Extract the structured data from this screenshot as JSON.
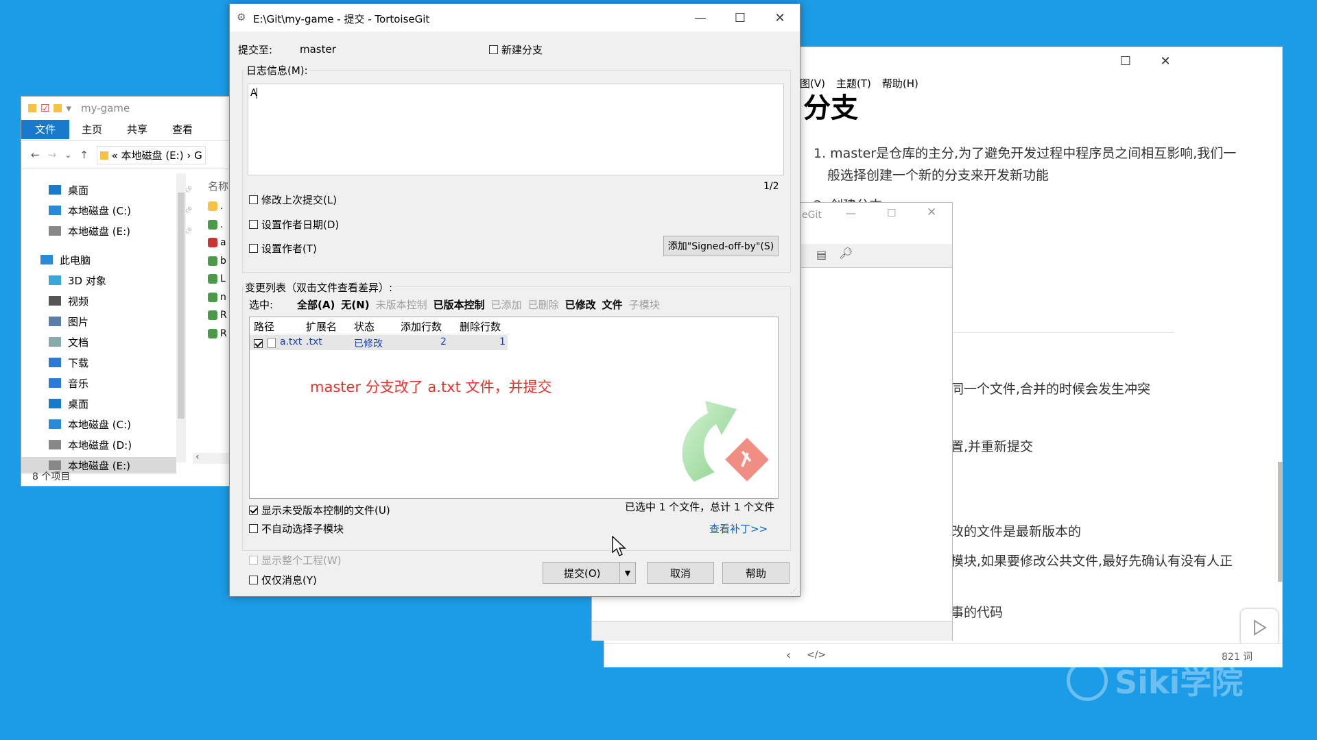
{
  "explorer": {
    "title": "my-game",
    "ribbon_tabs": [
      "文件",
      "主页",
      "共享",
      "查看"
    ],
    "address": "本地磁盘 (E:)",
    "address_prefix": "«",
    "address_next": "G",
    "column_name": "名称",
    "nav_items": [
      "桌面",
      "本地磁盘 (C:)",
      "本地磁盘 (E:)",
      "此电脑",
      "3D 对象",
      "视频",
      "图片",
      "文档",
      "下载",
      "音乐",
      "桌面",
      "本地磁盘 (C:)",
      "本地磁盘 (D:)",
      "本地磁盘 (E:)"
    ],
    "file_letters": [
      ".",
      ".",
      "a",
      "b",
      "L",
      "n",
      "R",
      "R"
    ],
    "status": "8 个项目"
  },
  "doc": {
    "menu": [
      "图(V)",
      "主题(T)",
      "帮助(H)"
    ],
    "heading": "分支",
    "list1": "1. master是仓库的主分,为了避免开发过程中程序员之间相互影响,我们一",
    "list1b": "般选择创建一个新的分支来开发新功能",
    "list2": "2. 创建分支",
    "p1": "同一个文件,合并的时候会发生冲突",
    "p2": "置,并重新提交",
    "p3": "改的文件是最新版本的",
    "p4": "模块,如果要修改公共文件,最好先确认有没有人正",
    "p5": "事的代码",
    "word_count": "821 词",
    "code_icon": "</>"
  },
  "tgit2": {
    "title": "eGit"
  },
  "dialog": {
    "title": "E:\\Git\\my-game - 提交 - TortoiseGit",
    "commit_to_label": "提交至:",
    "branch": "master",
    "new_branch": "新建分支",
    "log_label": "日志信息(M):",
    "message": "A",
    "page_indicator": "1/2",
    "amend": "修改上次提交(L)",
    "set_date": "设置作者日期(D)",
    "set_author": "设置作者(T)",
    "signed_off": "添加\"Signed-off-by\"(S)",
    "changes_label": "变更列表（双击文件查看差异）:",
    "select_label": "选中:",
    "filters": [
      {
        "label": "全部(A)",
        "style": "bold"
      },
      {
        "label": "无(N)",
        "style": "bold"
      },
      {
        "label": "未版本控制",
        "style": "gray"
      },
      {
        "label": "已版本控制",
        "style": "bold"
      },
      {
        "label": "已添加",
        "style": "gray"
      },
      {
        "label": "已删除",
        "style": "gray"
      },
      {
        "label": "已修改",
        "style": "bold"
      },
      {
        "label": "文件",
        "style": "bold"
      },
      {
        "label": "子模块",
        "style": "gray"
      }
    ],
    "columns": [
      "路径",
      "扩展名",
      "状态",
      "添加行数",
      "删除行数"
    ],
    "file": {
      "path": "a.txt",
      "ext": ".txt",
      "status": "已修改",
      "added": "2",
      "deleted": "1"
    },
    "annotation": "master 分支改了 a.txt 文件，并提交",
    "show_unversioned": "显示未受版本控制的文件(U)",
    "no_autoselect": "不自动选择子模块",
    "selected_summary": "已选中 1 个文件，总计 1 个文件",
    "view_patch": "查看补丁>>",
    "show_whole": "显示整个工程(W)",
    "msg_only": "仅仅消息(Y)",
    "commit_btn": "提交(O)",
    "cancel_btn": "取消",
    "help_btn": "帮助",
    "colors": {
      "annotation": "#e8322b",
      "link": "#0066cc",
      "status": "#1a3fb0"
    }
  },
  "watermark": "Siki学院"
}
